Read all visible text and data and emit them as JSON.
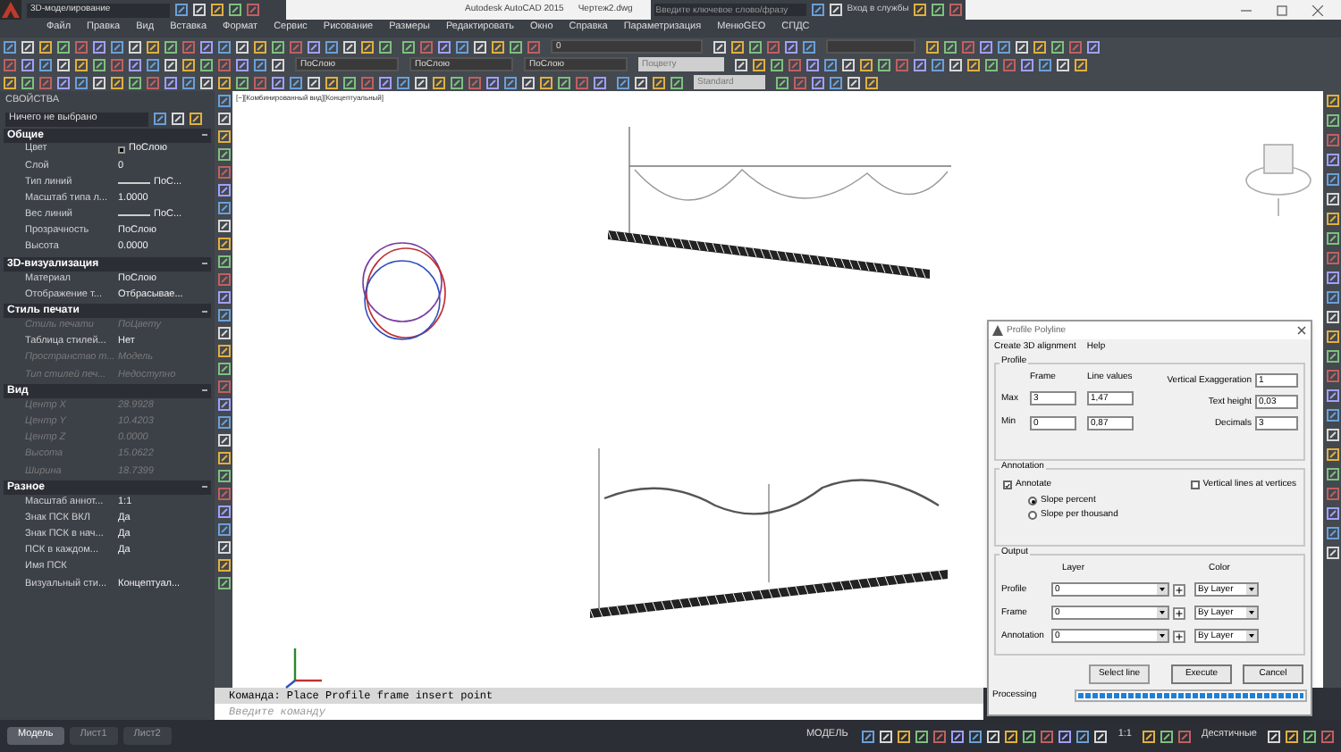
{
  "title_bar": {
    "workspace": "3D-моделирование",
    "title": "Autodesk AutoCAD 2015",
    "file": "Чертеж2.dwg",
    "search": {
      "placeholder": "Введите ключевое слово/фразу"
    },
    "signin": "Вход в службы"
  },
  "menu": [
    "Файл",
    "Правка",
    "Вид",
    "Вставка",
    "Формат",
    "Сервис",
    "Рисование",
    "Размеры",
    "Редактировать",
    "Окно",
    "Справка",
    "Параметризация",
    "МенюGEO",
    "СПДС"
  ],
  "toolbar": {
    "layer": "0",
    "color_value": "ПоСлою",
    "linetype": "ПоСлою",
    "lineweight": "ПоСлою",
    "plot_style": "Поцвету",
    "text_style": "Standard"
  },
  "properties": {
    "title": "СВОЙСТВА",
    "selection": "Ничего не выбрано",
    "sections": [
      {
        "name": "Общие",
        "expanded": true,
        "rows": [
          {
            "name": "Цвет",
            "value": "ПоСлою",
            "kind": "color",
            "disabled": false
          },
          {
            "name": "Слой",
            "value": "0",
            "kind": "text",
            "disabled": false
          },
          {
            "name": "Тип линий",
            "value": "ПоС...",
            "kind": "line",
            "disabled": false
          },
          {
            "name": "Масштаб типа л...",
            "value": "1.0000",
            "kind": "text",
            "disabled": false
          },
          {
            "name": "Вес линий",
            "value": "ПоС...",
            "kind": "line",
            "disabled": false
          },
          {
            "name": "Прозрачность",
            "value": "ПоСлою",
            "kind": "text",
            "disabled": false
          },
          {
            "name": "Высота",
            "value": "0.0000",
            "kind": "text",
            "disabled": false
          }
        ]
      },
      {
        "name": "3D-визуализация",
        "expanded": true,
        "rows": [
          {
            "name": "Материал",
            "value": "ПоСлою",
            "kind": "text",
            "disabled": false
          },
          {
            "name": "Отображение т...",
            "value": "Отбрасывае...",
            "kind": "text",
            "disabled": false
          }
        ]
      },
      {
        "name": "Стиль печати",
        "expanded": true,
        "rows": [
          {
            "name": "Стиль печати",
            "value": "ПоЦвету",
            "kind": "text",
            "disabled": true
          },
          {
            "name": "Таблица стилей...",
            "value": "Нет",
            "kind": "text",
            "disabled": false
          },
          {
            "name": "Пространство т...",
            "value": "Модель",
            "kind": "text",
            "disabled": true
          },
          {
            "name": "Тип стилей печ...",
            "value": "Недоступно",
            "kind": "text",
            "disabled": true
          }
        ]
      },
      {
        "name": "Вид",
        "expanded": true,
        "rows": [
          {
            "name": "Центр X",
            "value": "28.9928",
            "kind": "text",
            "disabled": true
          },
          {
            "name": "Центр Y",
            "value": "10.4203",
            "kind": "text",
            "disabled": true
          },
          {
            "name": "Центр Z",
            "value": "0.0000",
            "kind": "text",
            "disabled": true
          },
          {
            "name": "Высота",
            "value": "15.0622",
            "kind": "text",
            "disabled": true
          },
          {
            "name": "Ширина",
            "value": "18.7399",
            "kind": "text",
            "disabled": true
          }
        ]
      },
      {
        "name": "Разное",
        "expanded": true,
        "rows": [
          {
            "name": "Масштаб аннот...",
            "value": "1:1",
            "kind": "text",
            "disabled": false
          },
          {
            "name": "Знак ПСК ВКЛ",
            "value": "Да",
            "kind": "text",
            "disabled": false
          },
          {
            "name": "Знак ПСК в нач...",
            "value": "Да",
            "kind": "text",
            "disabled": false
          },
          {
            "name": "ПСК в каждом...",
            "value": "Да",
            "kind": "text",
            "disabled": false
          },
          {
            "name": "Имя ПСК",
            "value": "",
            "kind": "text",
            "disabled": false
          },
          {
            "name": "Визуальный сти...",
            "value": "Концептуал...",
            "kind": "text",
            "disabled": false
          }
        ]
      }
    ]
  },
  "viewport_label": "[−][Комбинированный вид][Концептуальный]",
  "dialog": {
    "title": "Profile Polyline",
    "menu": [
      "Create 3D alignment",
      "Help"
    ],
    "profile": {
      "legend": "Profile",
      "col_frame": "Frame",
      "col_line": "Line values",
      "rows": [
        {
          "label": "Max",
          "frame": "3",
          "line": "1,47"
        },
        {
          "label": "Min",
          "frame": "0",
          "line": "0,87"
        }
      ],
      "options": [
        {
          "label": "Vertical Exaggeration",
          "value": "1"
        },
        {
          "label": "Text height",
          "value": "0,03"
        },
        {
          "label": "Decimals",
          "value": "3"
        }
      ]
    },
    "annotation": {
      "legend": "Annotation",
      "annotate": {
        "label": "Annotate",
        "checked": true
      },
      "vertical_lines": {
        "label": "Vertical lines at vertices",
        "checked": false
      },
      "slope": [
        {
          "label": "Slope percent",
          "selected": true
        },
        {
          "label": "Slope per thousand",
          "selected": false
        }
      ]
    },
    "output": {
      "legend": "Output",
      "col_layer": "Layer",
      "col_color": "Color",
      "rows": [
        {
          "label": "Profile",
          "layer": "0",
          "color_choice": "By Layer"
        },
        {
          "label": "Frame",
          "layer": "0",
          "color_choice": "By Layer"
        },
        {
          "label": "Annotation",
          "layer": "0",
          "color_choice": "By Layer"
        }
      ]
    },
    "buttons": [
      "Select line",
      "Execute",
      "Cancel"
    ],
    "processing": {
      "label": "Processing",
      "level": 1
    }
  },
  "command": {
    "history": "Команда: Place Profile frame insert point",
    "placeholder": "Введите команду"
  },
  "layout_tabs": [
    {
      "label": "Модель",
      "selected": true
    },
    {
      "label": "Лист1",
      "selected": false
    },
    {
      "label": "Лист2",
      "selected": false
    }
  ],
  "status_bar": {
    "model": "МОДЕЛЬ",
    "scale": "1:1",
    "units": "Десятичные"
  }
}
